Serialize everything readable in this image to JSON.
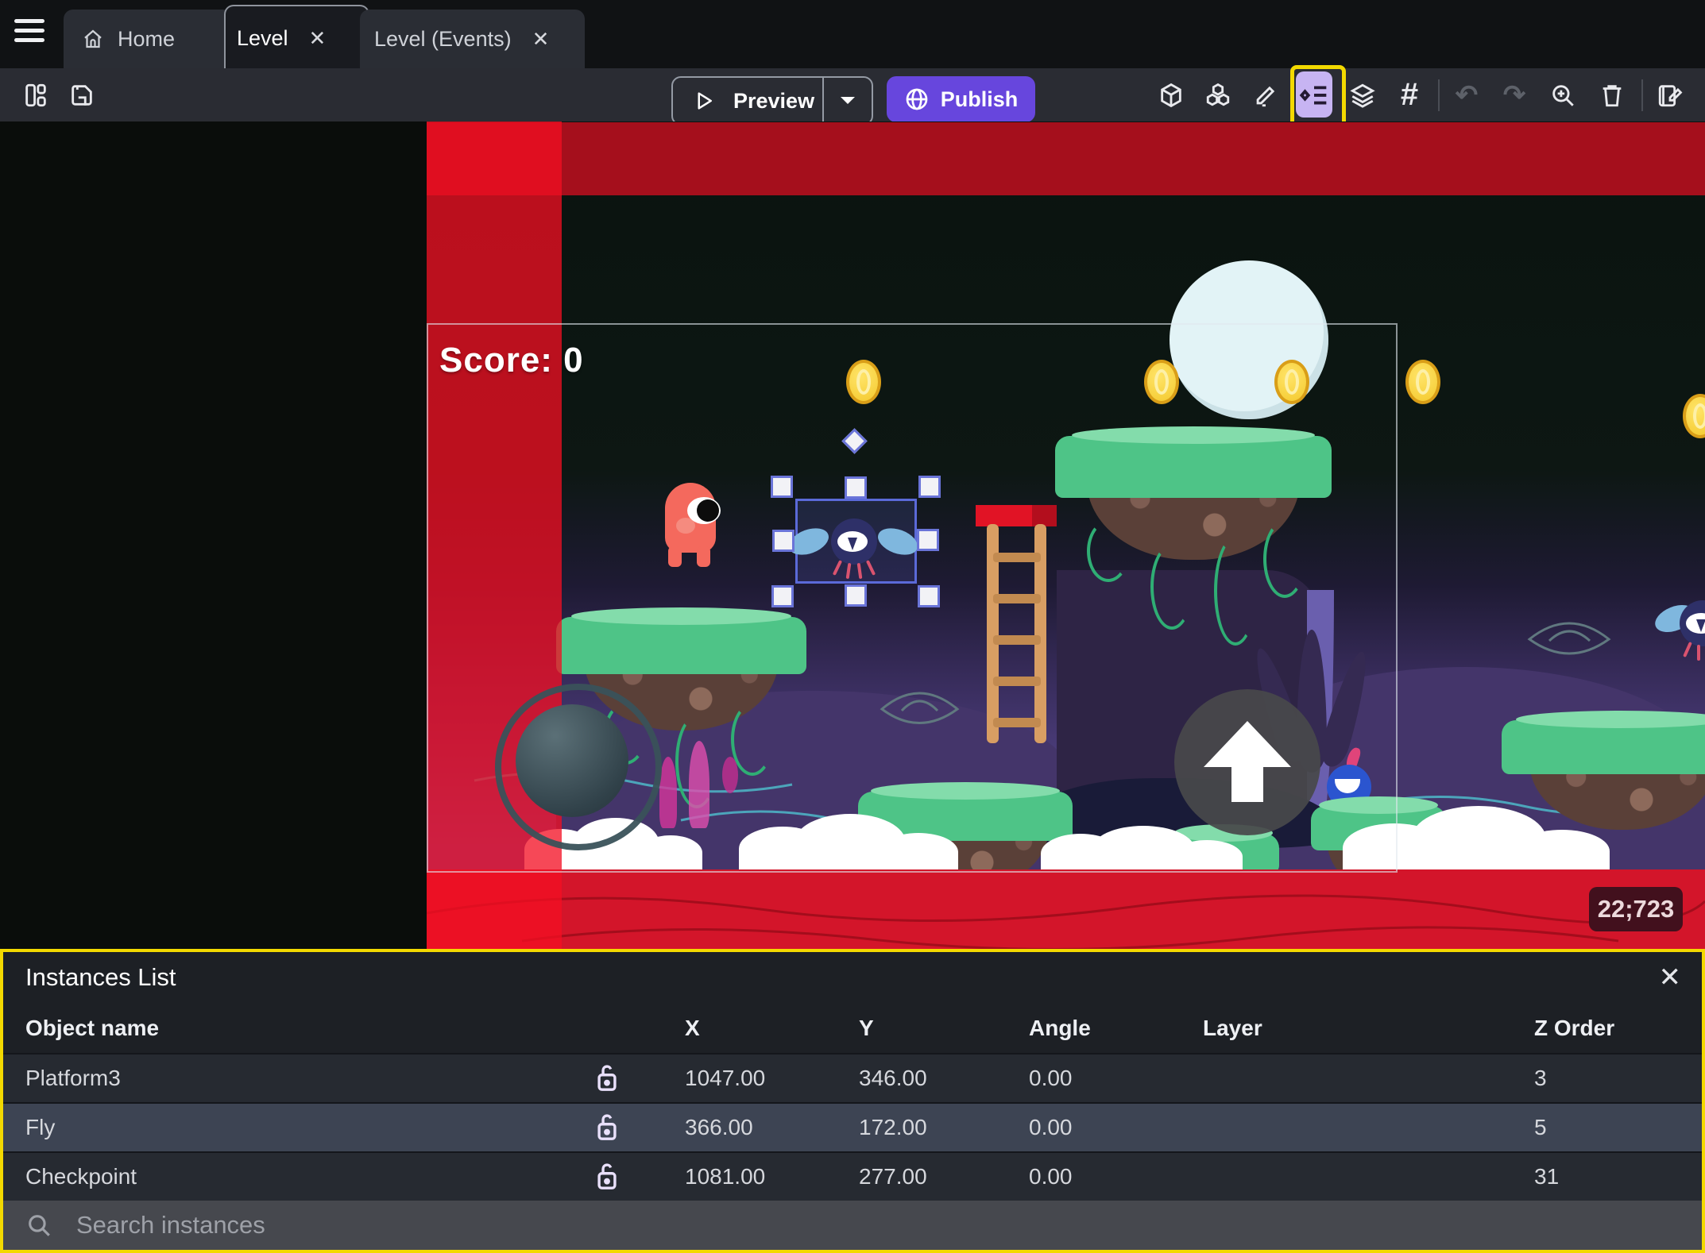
{
  "tabs": {
    "home": "Home",
    "level": "Level",
    "level_events": "Level (Events)",
    "close_glyph": "✕"
  },
  "toolbar": {
    "preview_label": "Preview",
    "publish_label": "Publish",
    "grid_glyph": "#",
    "undo_glyph": "↶",
    "redo_glyph": "↷"
  },
  "canvas": {
    "score_text": "Score: 0",
    "coords_badge": "22;723"
  },
  "instances_panel": {
    "title": "Instances List",
    "close_glyph": "✕",
    "columns": {
      "name": "Object name",
      "x": "X",
      "y": "Y",
      "angle": "Angle",
      "layer": "Layer",
      "z": "Z Order"
    },
    "rows": [
      {
        "name": "Platform3",
        "x": "1047.00",
        "y": "346.00",
        "angle": "0.00",
        "layer": "",
        "z": "3"
      },
      {
        "name": "Fly",
        "x": "366.00",
        "y": "172.00",
        "angle": "0.00",
        "layer": "",
        "z": "5"
      },
      {
        "name": "Checkpoint",
        "x": "1081.00",
        "y": "277.00",
        "angle": "0.00",
        "layer": "",
        "z": "31"
      }
    ],
    "search_placeholder": "Search instances"
  },
  "colors": {
    "accent_purple": "#6746dd",
    "highlight_yellow": "#f3d900",
    "scene_red": "#d3152a",
    "selection_blue": "#5b6ad8",
    "instances_icon_bg": "#c7b4f2"
  }
}
